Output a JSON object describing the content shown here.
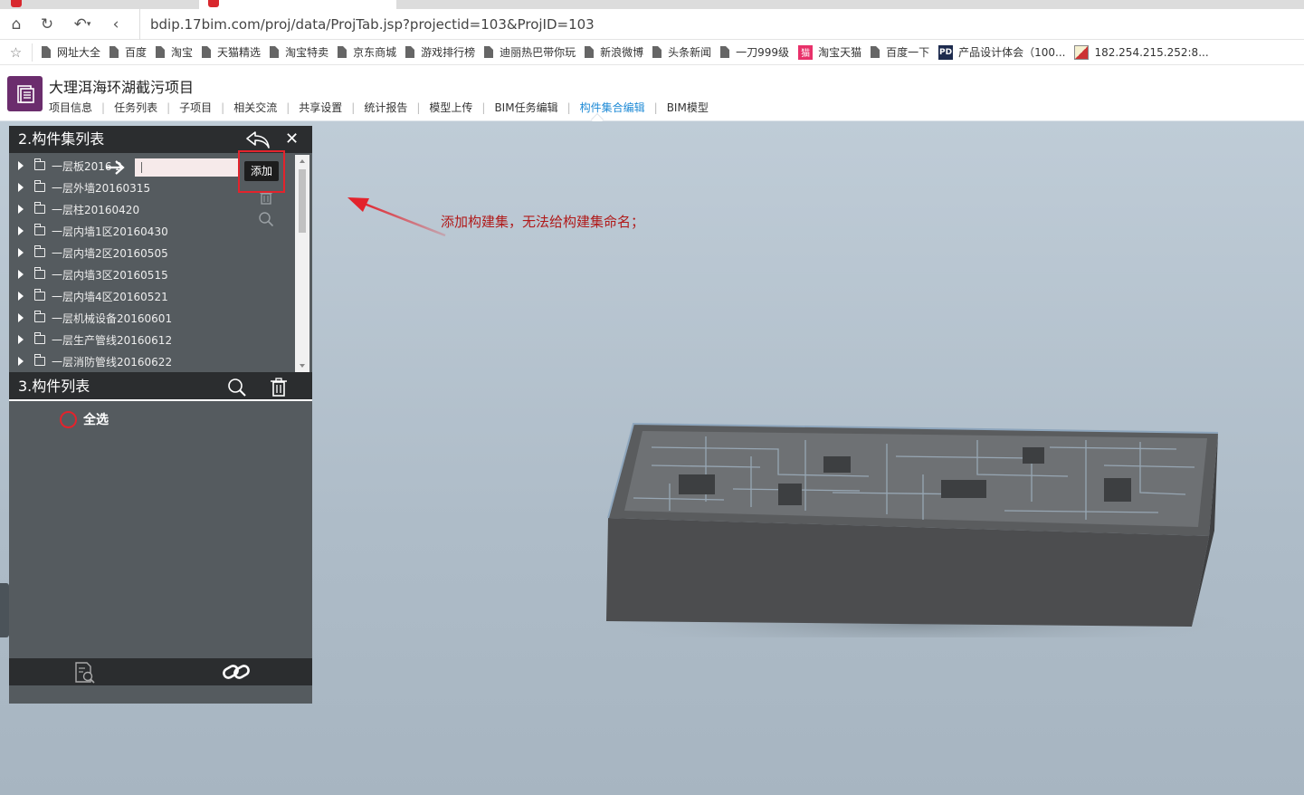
{
  "browser": {
    "url": "bdip.17bim.com/proj/data/ProjTab.jsp?projectid=103&ProjID=103",
    "bookmarks": [
      {
        "label": "网址大全",
        "icon": "doc-icon"
      },
      {
        "label": "百度",
        "icon": "doc-icon"
      },
      {
        "label": "淘宝",
        "icon": "doc-icon"
      },
      {
        "label": "天猫精选",
        "icon": "doc-icon"
      },
      {
        "label": "淘宝特卖",
        "icon": "doc-icon"
      },
      {
        "label": "京东商城",
        "icon": "doc-icon"
      },
      {
        "label": "游戏排行榜",
        "icon": "doc-icon"
      },
      {
        "label": "迪丽热巴带你玩",
        "icon": "doc-icon"
      },
      {
        "label": "新浪微博",
        "icon": "doc-icon"
      },
      {
        "label": "头条新闻",
        "icon": "doc-icon"
      },
      {
        "label": "一刀999级",
        "icon": "doc-icon"
      },
      {
        "label": "淘宝天猫",
        "icon": "tmall-icon"
      },
      {
        "label": "百度一下",
        "icon": "doc-icon"
      },
      {
        "label": "产品设计体会（100...",
        "icon": "pd-icon"
      },
      {
        "label": "182.254.215.252:8...",
        "icon": "ip-icon"
      }
    ]
  },
  "app": {
    "title": "大理洱海环湖截污项目",
    "nav": [
      "项目信息",
      "任务列表",
      "子项目",
      "相关交流",
      "共享设置",
      "统计报告",
      "模型上传",
      "BIM任务编辑",
      "构件集合编辑",
      "BIM模型"
    ],
    "active_nav": "构件集合编辑"
  },
  "panel": {
    "sets_title": "2.构件集列表",
    "sets": [
      {
        "label": "一层板2016  2"
      },
      {
        "label": "一层外墙20160315"
      },
      {
        "label": "一层柱20160420"
      },
      {
        "label": "一层内墙1区20160430"
      },
      {
        "label": "一层内墙2区20160505"
      },
      {
        "label": "一层内墙3区20160515"
      },
      {
        "label": "一层内墙4区20160521"
      },
      {
        "label": "一层机械设备20160601"
      },
      {
        "label": "一层生产管线20160612"
      },
      {
        "label": "一层消防管线20160622"
      }
    ],
    "add_tooltip": "添加",
    "components_title": "3.构件列表",
    "select_all": "全选"
  },
  "annotation": {
    "text": "添加构建集，无法给构建集命名；",
    "color": "#b01a1a"
  },
  "colors": {
    "panel_bg": "#555b5f",
    "panel_header": "#2b2d2f",
    "accent": "#1e8ad6",
    "highlight": "#e3232c"
  }
}
